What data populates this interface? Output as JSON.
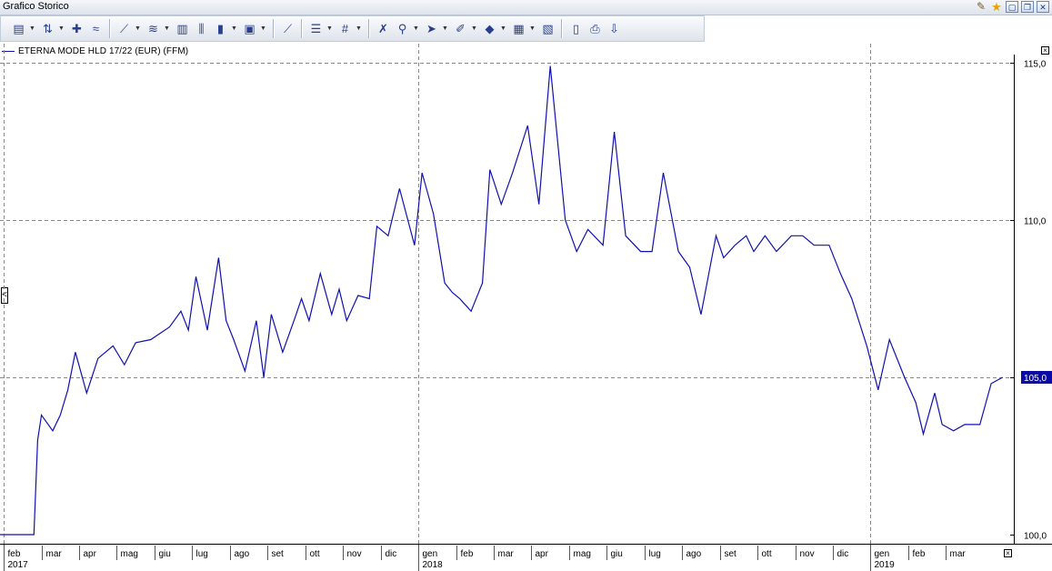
{
  "window": {
    "title": "Grafico Storico",
    "buttons": [
      {
        "name": "settings-tool-icon",
        "glyph": "✎"
      },
      {
        "name": "favorite-star-icon",
        "glyph": "★"
      },
      {
        "name": "maximize-icon",
        "glyph": "▢"
      },
      {
        "name": "restore-icon",
        "glyph": "❐"
      },
      {
        "name": "close-icon",
        "glyph": "✕"
      }
    ]
  },
  "toolbar": {
    "groups": [
      [
        {
          "icon": "chart-type-icon",
          "glyph": "▤",
          "dropdown": true
        },
        {
          "icon": "compare-icon",
          "glyph": "⇅",
          "dropdown": true
        },
        {
          "icon": "add-study-icon",
          "glyph": "✚"
        },
        {
          "icon": "remove-study-icon",
          "glyph": "≈"
        }
      ],
      [
        {
          "icon": "line-chart-icon",
          "glyph": "⟋",
          "dropdown": true
        },
        {
          "icon": "indicator-icon",
          "glyph": "≋",
          "dropdown": true
        },
        {
          "icon": "volume-bars-icon",
          "glyph": "▥"
        },
        {
          "icon": "ohlc-icon",
          "glyph": "⫼"
        },
        {
          "icon": "candlestick-icon",
          "glyph": "▮",
          "dropdown": true
        },
        {
          "icon": "period-icon",
          "glyph": "▣",
          "dropdown": true
        }
      ],
      [
        {
          "icon": "trendline-icon",
          "glyph": "⟋"
        }
      ],
      [
        {
          "icon": "horizontal-lines-icon",
          "glyph": "☰",
          "dropdown": true
        },
        {
          "icon": "grid-icon",
          "glyph": "#",
          "dropdown": true
        }
      ],
      [
        {
          "icon": "delete-drawings-icon",
          "glyph": "✗"
        },
        {
          "icon": "zoom-icon",
          "glyph": "⚲",
          "dropdown": true
        },
        {
          "icon": "cursor-icon",
          "glyph": "➤",
          "dropdown": true
        },
        {
          "icon": "pen-icon",
          "glyph": "✐",
          "dropdown": true
        },
        {
          "icon": "color-fill-icon",
          "glyph": "◆",
          "dropdown": true
        },
        {
          "icon": "templates-icon",
          "glyph": "▦",
          "dropdown": true
        },
        {
          "icon": "clipboard-paste-icon",
          "glyph": "▧"
        }
      ],
      [
        {
          "icon": "copy-icon",
          "glyph": "▯"
        },
        {
          "icon": "print-icon",
          "glyph": "⎙"
        },
        {
          "icon": "export-icon",
          "glyph": "⇩"
        }
      ]
    ]
  },
  "chart_data": {
    "type": "line",
    "legend": "ETERNA MODE HLD  17/22 (EUR) (FFM)",
    "series": [
      {
        "name": "ETERNA MODE HLD  17/22 (EUR) (FFM)",
        "color": "#1010b0",
        "x": [
          0,
          0.5,
          0.9,
          1.0,
          1.1,
          1.4,
          1.6,
          1.8,
          2.0,
          2.3,
          2.6,
          3.0,
          3.3,
          3.6,
          4.0,
          4.5,
          4.8,
          5.0,
          5.2,
          5.5,
          5.8,
          6.0,
          6.2,
          6.5,
          6.8,
          7.0,
          7.2,
          7.5,
          7.8,
          8.0,
          8.2,
          8.5,
          8.8,
          9.0,
          9.2,
          9.5,
          9.8,
          10.0,
          10.3,
          10.6,
          11.0,
          11.2,
          11.5,
          11.8,
          12.0,
          12.2,
          12.5,
          12.8,
          13.0,
          13.3,
          13.6,
          14.0,
          14.3,
          14.6,
          15.0,
          15.3,
          15.6,
          16.0,
          16.3,
          16.6,
          17.0,
          17.3,
          17.6,
          18.0,
          18.3,
          18.6,
          19.0,
          19.2,
          19.5,
          19.8,
          20.0,
          20.3,
          20.6,
          21.0,
          21.3,
          21.6,
          22.0,
          22.3,
          22.6,
          23.0,
          23.3,
          23.6,
          24.0,
          24.3,
          24.5,
          24.8,
          25.0,
          25.3,
          25.6,
          26.0,
          26.3,
          26.6
        ],
        "y": [
          100.0,
          100.0,
          100.0,
          103.0,
          103.8,
          103.3,
          103.8,
          104.6,
          105.8,
          104.5,
          105.6,
          106.0,
          105.4,
          106.1,
          106.2,
          106.6,
          107.1,
          106.5,
          108.2,
          106.5,
          108.8,
          106.8,
          106.2,
          105.2,
          106.8,
          105.0,
          107.0,
          105.8,
          106.8,
          107.5,
          106.8,
          108.3,
          107.0,
          107.8,
          106.8,
          107.6,
          107.5,
          109.8,
          109.5,
          111.0,
          109.2,
          111.5,
          110.2,
          108.0,
          107.7,
          107.5,
          107.1,
          108.0,
          111.6,
          110.5,
          111.5,
          113.0,
          110.5,
          114.9,
          110.0,
          109.0,
          109.7,
          109.2,
          112.8,
          109.5,
          109.0,
          109.0,
          111.5,
          109.0,
          108.5,
          107.0,
          109.5,
          108.8,
          109.2,
          109.5,
          109.0,
          109.5,
          109.0,
          109.5,
          109.5,
          109.2,
          109.2,
          108.3,
          107.5,
          106.0,
          104.6,
          106.2,
          105.0,
          104.2,
          103.2,
          104.5,
          103.5,
          103.3,
          103.5,
          103.5,
          104.8,
          105.0
        ],
        "last_value_label": "105,0"
      }
    ],
    "x_month_labels": [
      "feb",
      "mar",
      "apr",
      "mag",
      "giu",
      "lug",
      "ago",
      "set",
      "ott",
      "nov",
      "dic",
      "gen",
      "feb",
      "mar",
      "apr",
      "mag",
      "giu",
      "lug",
      "ago",
      "set",
      "ott",
      "nov",
      "dic",
      "gen",
      "feb",
      "mar"
    ],
    "x_year_labels": [
      {
        "month_index": 0,
        "label": "2017"
      },
      {
        "month_index": 11,
        "label": "2018"
      },
      {
        "month_index": 23,
        "label": "2019"
      }
    ],
    "y_ticks": [
      {
        "value": 100,
        "label": "100,0"
      },
      {
        "value": 105,
        "label": "105,0"
      },
      {
        "value": 110,
        "label": "110,0"
      },
      {
        "value": 115,
        "label": "115,0"
      }
    ],
    "ylim": [
      100,
      115
    ],
    "xlim": [
      0,
      26.9
    ],
    "grid": true,
    "legend_placement": "top-left"
  }
}
